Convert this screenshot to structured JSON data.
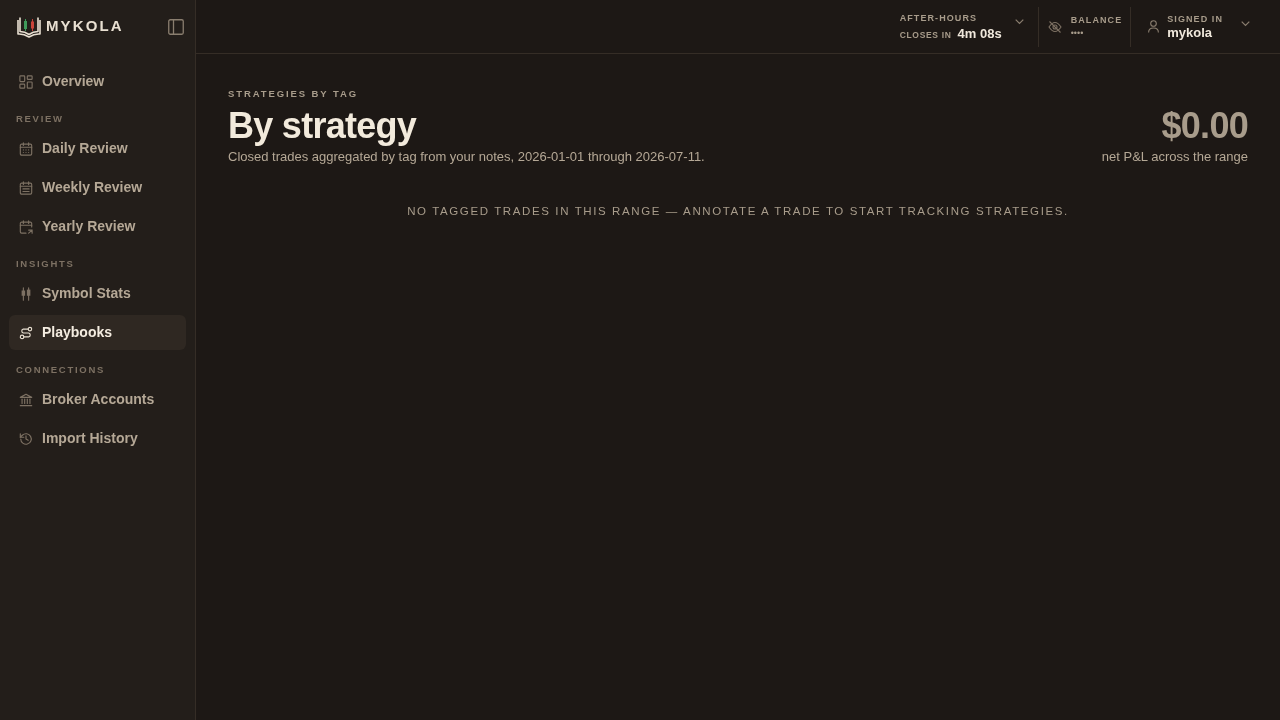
{
  "sidebar": {
    "brand": "MYKOLA",
    "sections": [
      {
        "items": [
          {
            "label": "Overview",
            "selected": false
          }
        ]
      },
      {
        "heading": "REVIEW",
        "items": [
          {
            "label": "Daily Review",
            "selected": false
          },
          {
            "label": "Weekly Review",
            "selected": false
          },
          {
            "label": "Yearly Review",
            "selected": false
          }
        ]
      },
      {
        "heading": "INSIGHTS",
        "items": [
          {
            "label": "Symbol Stats",
            "selected": false
          },
          {
            "label": "Playbooks",
            "selected": true
          }
        ]
      },
      {
        "heading": "CONNECTIONS",
        "items": [
          {
            "label": "Broker Accounts",
            "selected": false
          },
          {
            "label": "Import History",
            "selected": false
          }
        ]
      }
    ]
  },
  "header": {
    "session": {
      "label": "AFTER-HOURS",
      "countdown_label": "CLOSES IN",
      "countdown": "4m 08s"
    },
    "balance": {
      "label": "BALANCE",
      "value": "••••"
    },
    "account": {
      "label": "SIGNED IN",
      "username": "mykola"
    }
  },
  "page": {
    "eyebrow": "STRATEGIES BY TAG",
    "title": "By strategy",
    "subtitle": "Closed trades aggregated by tag from your notes, 2026-01-01 through 2026-07-11.",
    "total": {
      "value": "$0.00",
      "caption": "net P&L across the range"
    },
    "empty_message": "NO TAGGED TRADES IN THIS RANGE — ANNOTATE A TRADE TO START TRACKING STRATEGIES."
  }
}
